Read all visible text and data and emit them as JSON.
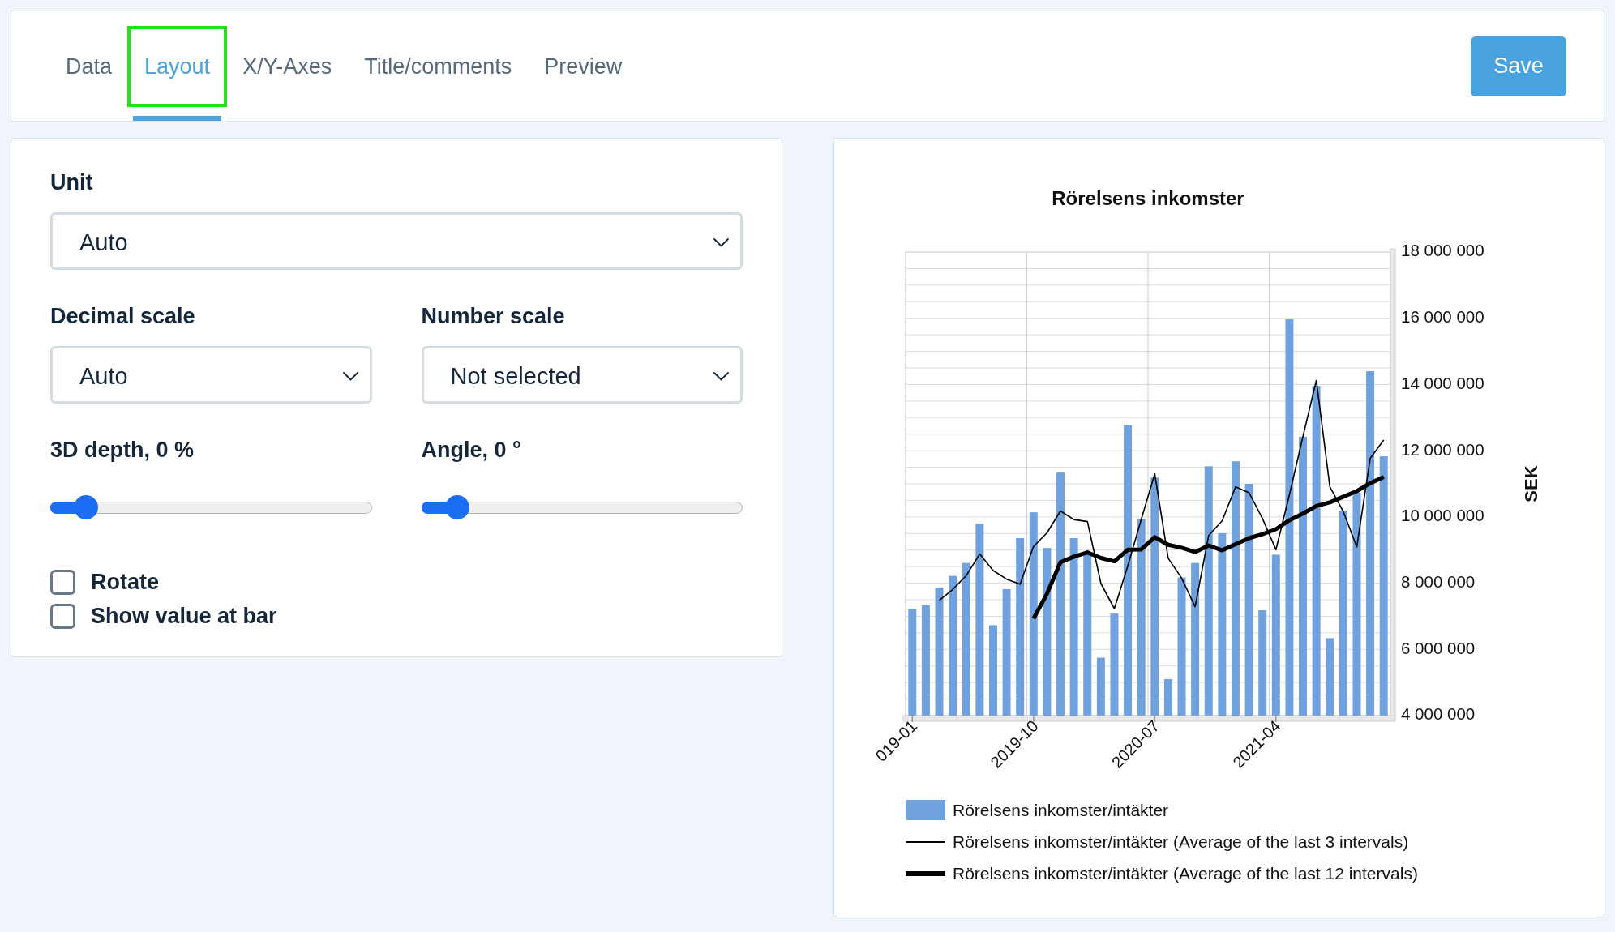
{
  "tabs": [
    {
      "label": "Data",
      "selected": false,
      "focused": false
    },
    {
      "label": "Layout",
      "selected": true,
      "focused": true
    },
    {
      "label": "X/Y-Axes",
      "selected": false,
      "focused": false
    },
    {
      "label": "Title/comments",
      "selected": false,
      "focused": false
    },
    {
      "label": "Preview",
      "selected": false,
      "focused": false
    }
  ],
  "save_button": "Save",
  "settings": {
    "unit": {
      "label": "Unit",
      "value": "Auto"
    },
    "scales": [
      {
        "label": "Decimal scale",
        "value": "Auto"
      },
      {
        "label": "Number scale",
        "value": "Not selected"
      }
    ],
    "sliders": [
      {
        "label": "3D depth, 0 %",
        "level": 0.11
      },
      {
        "label": "Angle, 0 °",
        "level": 0.11
      }
    ],
    "checkboxes": [
      {
        "label": "Rotate",
        "checked": false
      },
      {
        "label": "Show value at bar",
        "checked": false
      }
    ]
  },
  "chart": {
    "chart_data": {
      "type": "bar",
      "title": "Rörelsens inkomster",
      "ylabel": "SEK",
      "grid": true,
      "legend": "bottom",
      "categories": [
        "019-01",
        null,
        null,
        null,
        null,
        null,
        null,
        null,
        null,
        "2019-10",
        null,
        null,
        null,
        null,
        null,
        null,
        null,
        null,
        "2020-07",
        null,
        null,
        null,
        null,
        null,
        null,
        null,
        null,
        "2021-04",
        null,
        null,
        null,
        null,
        null,
        null,
        null,
        null
      ],
      "ylim": [
        4000000,
        18000000
      ],
      "yticks": [
        {
          "value": 4000000,
          "label": "4 000 000"
        },
        {
          "value": 6000000,
          "label": "6 000 000"
        },
        {
          "value": 8000000,
          "label": "8 000 000"
        },
        {
          "value": 10000000,
          "label": "10 000 000"
        },
        {
          "value": 12000000,
          "label": "12 000 000"
        },
        {
          "value": 14000000,
          "label": "14 000 000"
        },
        {
          "value": 16000000,
          "label": "16 000 000"
        },
        {
          "value": 18000000,
          "label": "18 000 000"
        }
      ],
      "series": [
        {
          "name": "Rörelsens inkomster/intäkter",
          "type": "bar",
          "color": "#6fa1dc",
          "values": [
            7230000,
            7330000,
            7870000,
            8220000,
            8610000,
            9800000,
            6730000,
            7820000,
            9360000,
            10140000,
            9060000,
            11340000,
            9360000,
            8870000,
            5750000,
            7080000,
            12770000,
            9950000,
            11190000,
            5100000,
            8170000,
            8610000,
            11530000,
            9510000,
            11680000,
            11000000,
            7180000,
            8860000,
            15980000,
            12420000,
            13960000,
            6340000,
            10190000,
            10730000,
            14400000,
            11830000
          ]
        },
        {
          "name": "Rörelsens inkomster/intäkter (Average of the last 3 intervals)",
          "type": "line",
          "color": "#000000",
          "values": [
            null,
            null,
            7480000,
            7810000,
            8230000,
            8880000,
            8380000,
            8120000,
            7970000,
            9110000,
            9520000,
            10180000,
            9920000,
            9860000,
            7990000,
            7230000,
            8530000,
            9930000,
            11300000,
            8750000,
            8150000,
            7290000,
            9440000,
            9880000,
            10910000,
            10730000,
            9950000,
            9010000,
            10670000,
            12420000,
            14120000,
            10910000,
            10160000,
            9090000,
            11770000,
            12320000
          ]
        },
        {
          "name": "Rörelsens inkomster/intäkter (Average of the last 12 intervals)",
          "type": "line",
          "color": "#000000",
          "values": [
            null,
            null,
            null,
            null,
            null,
            null,
            null,
            null,
            null,
            6930000,
            7680000,
            8630000,
            8800000,
            8930000,
            8760000,
            8660000,
            9010000,
            9020000,
            9390000,
            9160000,
            9070000,
            8940000,
            9140000,
            8990000,
            9180000,
            9360000,
            9480000,
            9630000,
            9900000,
            10100000,
            10330000,
            10440000,
            10610000,
            10780000,
            11020000,
            11210000
          ]
        }
      ]
    }
  }
}
